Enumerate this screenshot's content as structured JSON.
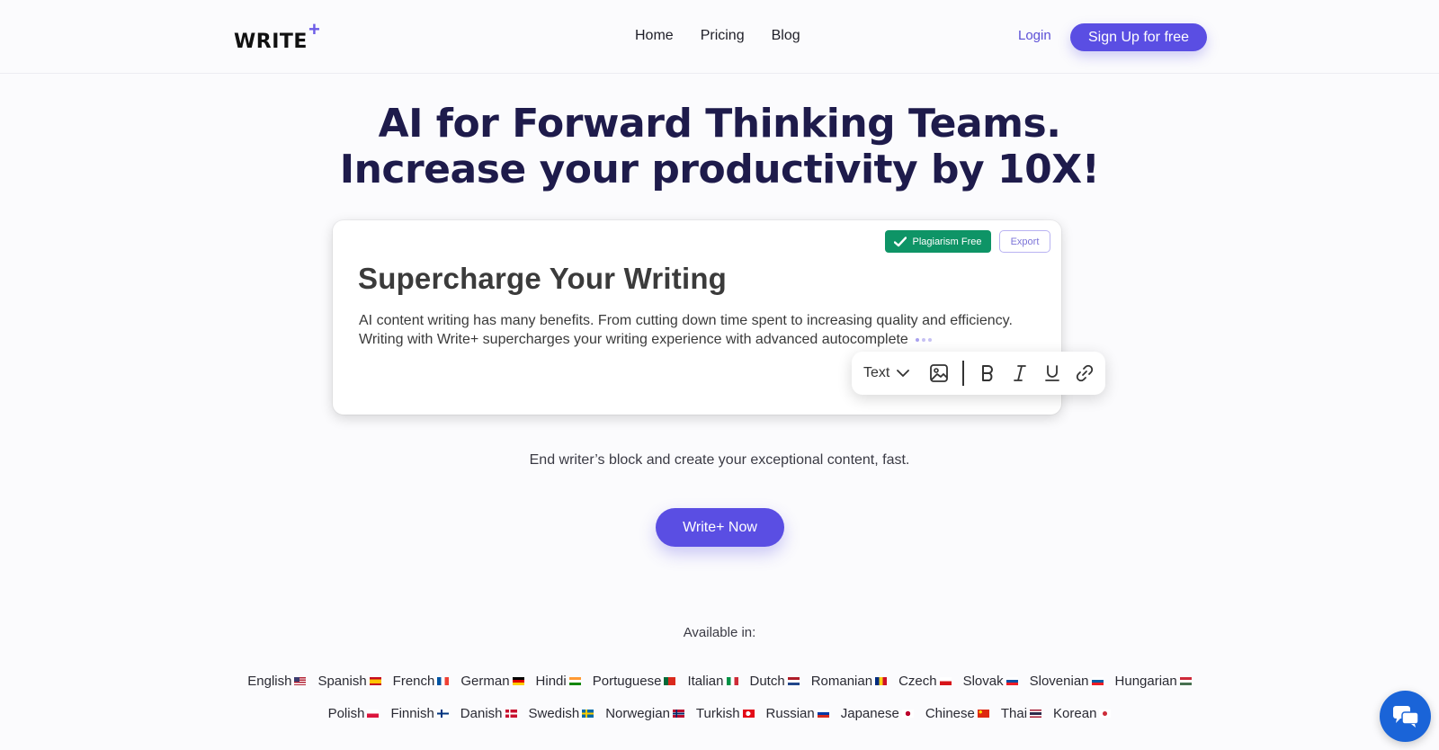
{
  "header": {
    "logo_text": "WRITE",
    "logo_plus": "+",
    "nav": [
      "Home",
      "Pricing",
      "Blog"
    ],
    "login": "Login",
    "signup": "Sign Up for free"
  },
  "hero": {
    "title_line1": "AI for Forward Thinking Teams.",
    "title_line2": "Increase your productivity by 10X!"
  },
  "editor": {
    "badge_plagiarism": "Plagiarism Free",
    "badge_export": "Export",
    "title": "Supercharge Your Writing",
    "body_line1": "AI content writing has many benefits. From cutting down time spent to increasing quality and efficiency.",
    "body_line2": "Writing with Write+ supercharges your writing experience with advanced autocomplete",
    "toolbar": {
      "text_dropdown": "Text",
      "icons": [
        "chevron-down-icon",
        "image-icon",
        "bold-icon",
        "italic-icon",
        "underline-icon",
        "link-icon"
      ]
    }
  },
  "subtitle": "End writer’s block and create your exceptional content, fast.",
  "cta": "Write+ Now",
  "available_label": "Available in:",
  "languages_row1": [
    {
      "name": "English",
      "flag": "us"
    },
    {
      "name": "Spanish",
      "flag": "es"
    },
    {
      "name": "French",
      "flag": "fr"
    },
    {
      "name": "German",
      "flag": "de"
    },
    {
      "name": "Hindi",
      "flag": "in"
    },
    {
      "name": "Portuguese",
      "flag": "pt"
    },
    {
      "name": "Italian",
      "flag": "it"
    },
    {
      "name": "Dutch",
      "flag": "nl"
    },
    {
      "name": "Romanian",
      "flag": "ro"
    },
    {
      "name": "Czech",
      "flag": "cz"
    },
    {
      "name": "Slovak",
      "flag": "sk"
    },
    {
      "name": "Slovenian",
      "flag": "si"
    },
    {
      "name": "Hungarian",
      "flag": "hu"
    }
  ],
  "languages_row2": [
    {
      "name": "Polish",
      "flag": "pl"
    },
    {
      "name": "Finnish",
      "flag": "fi"
    },
    {
      "name": "Danish",
      "flag": "dk"
    },
    {
      "name": "Swedish",
      "flag": "se"
    },
    {
      "name": "Norwegian",
      "flag": "no"
    },
    {
      "name": "Turkish",
      "flag": "tr"
    },
    {
      "name": "Russian",
      "flag": "ru"
    },
    {
      "name": "Japanese",
      "flag": "jp"
    },
    {
      "name": "Chinese",
      "flag": "cn"
    },
    {
      "name": "Thai",
      "flag": "th"
    },
    {
      "name": "Korean",
      "flag": "kr"
    }
  ],
  "chat_widget": {
    "icon": "chat-icon"
  },
  "colors": {
    "accent": "#5a4ee3",
    "title": "#1e1b4b",
    "badge_green": "#0e9466",
    "chat_blue": "#1a64d8"
  }
}
